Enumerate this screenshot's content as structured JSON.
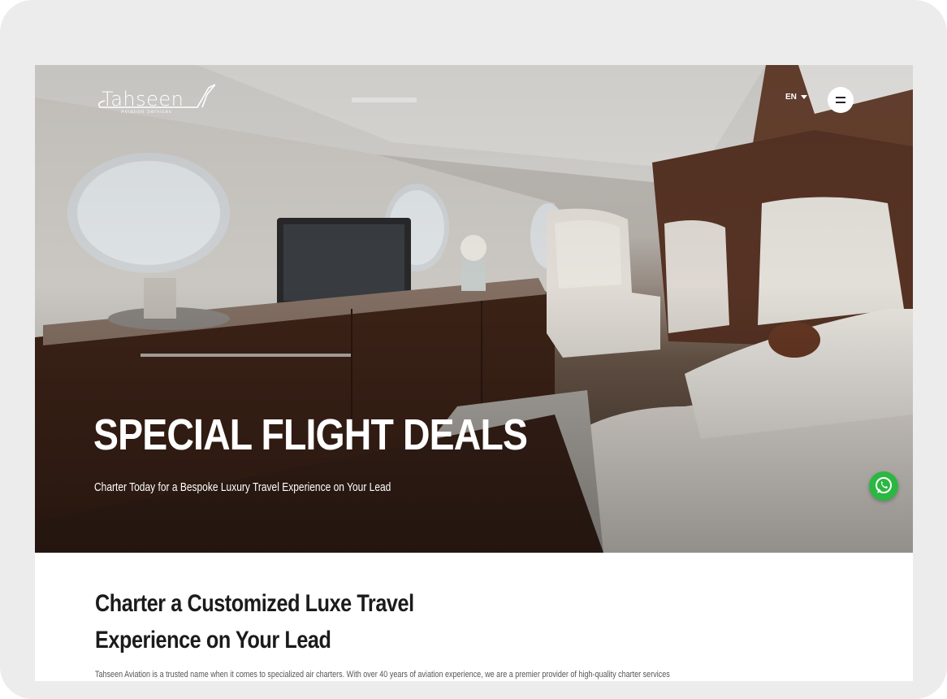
{
  "brand": {
    "name": "Tahseen",
    "tagline": "Aviation Services"
  },
  "header": {
    "language": "EN",
    "menu_icon": "menu-icon"
  },
  "hero": {
    "title": "SPECIAL FLIGHT DEALS",
    "subtitle": "Charter Today for a Bespoke Luxury Travel Experience on Your Lead",
    "image": "private-jet-cabin-interior"
  },
  "floating": {
    "whatsapp_icon": "whatsapp-icon",
    "whatsapp_color": "#2bb741"
  },
  "intro": {
    "heading_line1": "Charter a Customized Luxe Travel",
    "heading_line2": "Experience on Your Lead",
    "body": "Tahseen Aviation is a trusted name when it comes to specialized air charters. With over 40 years of aviation experience, we are a premier provider of high-quality charter services"
  }
}
